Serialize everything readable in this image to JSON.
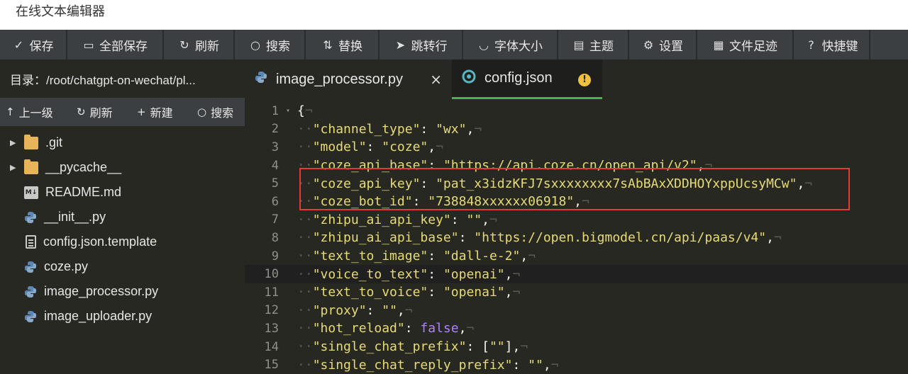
{
  "app": {
    "title": "在线文本编辑器"
  },
  "toolbar": [
    {
      "icon": "save-icon",
      "glyph": "✓",
      "label": "保存",
      "width": 95
    },
    {
      "icon": "save-all-icon",
      "glyph": "▭",
      "label": "全部保存",
      "width": 136
    },
    {
      "icon": "refresh-icon",
      "glyph": "↻",
      "label": "刷新",
      "width": 100
    },
    {
      "icon": "search-icon",
      "glyph": "○",
      "label": "搜索",
      "width": 100
    },
    {
      "icon": "replace-icon",
      "glyph": "⇅",
      "label": "替换",
      "width": 104
    },
    {
      "icon": "goto-line-icon",
      "glyph": "➤",
      "label": "跳转行",
      "width": 118
    },
    {
      "icon": "font-size-icon",
      "glyph": "◡",
      "label": "字体大小",
      "width": 134
    },
    {
      "icon": "theme-icon",
      "glyph": "▤",
      "label": "主题",
      "width": 100
    },
    {
      "icon": "gear-icon",
      "glyph": "⚙",
      "label": "设置",
      "width": 96
    },
    {
      "icon": "footprint-icon",
      "glyph": "▦",
      "label": "文件足迹",
      "width": 136
    },
    {
      "icon": "help-icon",
      "glyph": "?",
      "label": "快捷键",
      "width": 108
    }
  ],
  "sidebar": {
    "directory": "目录：/root/chatgpt-on-wechat/pl...",
    "actions": [
      {
        "icon": "arrow-up-icon",
        "glyph": "↑",
        "label": "上一级"
      },
      {
        "icon": "refresh-icon",
        "glyph": "↻",
        "label": "刷新"
      },
      {
        "icon": "plus-icon",
        "glyph": "+",
        "label": "新建"
      },
      {
        "icon": "search-icon",
        "glyph": "○",
        "label": "搜索"
      }
    ],
    "files": [
      {
        "name": ".git",
        "type": "folder"
      },
      {
        "name": "__pycache__",
        "type": "folder"
      },
      {
        "name": "README.md",
        "type": "md"
      },
      {
        "name": "__init__.py",
        "type": "py"
      },
      {
        "name": "config.json.template",
        "type": "doc"
      },
      {
        "name": "coze.py",
        "type": "py"
      },
      {
        "name": "image_processor.py",
        "type": "py"
      },
      {
        "name": "image_uploader.py",
        "type": "py"
      }
    ]
  },
  "tabs": [
    {
      "label": "image_processor.py",
      "active": false,
      "status": "close"
    },
    {
      "label": "config.json",
      "active": true,
      "status": "unsaved-warning",
      "warning_glyph": "!"
    }
  ],
  "editor": {
    "current_line": 10,
    "lines": [
      {
        "n": "1",
        "fold": "▾",
        "tokens": [
          [
            "p",
            "{"
          ]
        ]
      },
      {
        "n": "2",
        "tokens": [
          [
            "s",
            "\"channel_type\""
          ],
          [
            "p",
            ": "
          ],
          [
            "s",
            "\"wx\""
          ],
          [
            "p",
            ","
          ]
        ]
      },
      {
        "n": "3",
        "tokens": [
          [
            "s",
            "\"model\""
          ],
          [
            "p",
            ": "
          ],
          [
            "s",
            "\"coze\""
          ],
          [
            "p",
            ","
          ]
        ]
      },
      {
        "n": "4",
        "tokens": [
          [
            "s",
            "\"coze_api_base\""
          ],
          [
            "p",
            ": "
          ],
          [
            "s",
            "\"https://api.coze.cn/open_api/v2\""
          ],
          [
            "p",
            ","
          ]
        ]
      },
      {
        "n": "5",
        "tokens": [
          [
            "s",
            "\"coze_api_key\""
          ],
          [
            "p",
            ": "
          ],
          [
            "s",
            "\"pat_x3idzKFJ7sxxxxxxxx7sAbBAxXDDHOYxppUcsyMCw\""
          ],
          [
            "p",
            ","
          ]
        ]
      },
      {
        "n": "6",
        "tokens": [
          [
            "s",
            "\"coze_bot_id\""
          ],
          [
            "p",
            ": "
          ],
          [
            "s",
            "\"738848xxxxxx06918\""
          ],
          [
            "p",
            ","
          ]
        ]
      },
      {
        "n": "7",
        "tokens": [
          [
            "s",
            "\"zhipu_ai_api_key\""
          ],
          [
            "p",
            ": "
          ],
          [
            "s",
            "\"\""
          ],
          [
            "p",
            ","
          ]
        ]
      },
      {
        "n": "8",
        "tokens": [
          [
            "s",
            "\"zhipu_ai_api_base\""
          ],
          [
            "p",
            ": "
          ],
          [
            "s",
            "\"https://open.bigmodel.cn/api/paas/v4\""
          ],
          [
            "p",
            ","
          ]
        ]
      },
      {
        "n": "9",
        "tokens": [
          [
            "s",
            "\"text_to_image\""
          ],
          [
            "p",
            ": "
          ],
          [
            "s",
            "\"dall-e-2\""
          ],
          [
            "p",
            ","
          ]
        ]
      },
      {
        "n": "10",
        "tokens": [
          [
            "s",
            "\"voice_to_text\""
          ],
          [
            "p",
            ": "
          ],
          [
            "s",
            "\"openai\""
          ],
          [
            "p",
            ","
          ]
        ]
      },
      {
        "n": "11",
        "tokens": [
          [
            "s",
            "\"text_to_voice\""
          ],
          [
            "p",
            ": "
          ],
          [
            "s",
            "\"openai\""
          ],
          [
            "p",
            ","
          ]
        ]
      },
      {
        "n": "12",
        "tokens": [
          [
            "s",
            "\"proxy\""
          ],
          [
            "p",
            ": "
          ],
          [
            "s",
            "\"\""
          ],
          [
            "p",
            ","
          ]
        ]
      },
      {
        "n": "13",
        "tokens": [
          [
            "s",
            "\"hot_reload\""
          ],
          [
            "p",
            ": "
          ],
          [
            "k",
            "false"
          ],
          [
            "p",
            ","
          ]
        ]
      },
      {
        "n": "14",
        "tokens": [
          [
            "s",
            "\"single_chat_prefix\""
          ],
          [
            "p",
            ": ["
          ],
          [
            "s",
            "\"\""
          ],
          [
            "p",
            "],"
          ]
        ]
      },
      {
        "n": "15",
        "tokens": [
          [
            "s",
            "\"single_chat_reply_prefix\""
          ],
          [
            "p",
            ": "
          ],
          [
            "s",
            "\"\""
          ],
          [
            "p",
            ","
          ]
        ]
      }
    ]
  },
  "colors": {
    "highlight_box": "#e53935",
    "active_tab_accent": "#4caf50",
    "warning": "#f0c040"
  }
}
